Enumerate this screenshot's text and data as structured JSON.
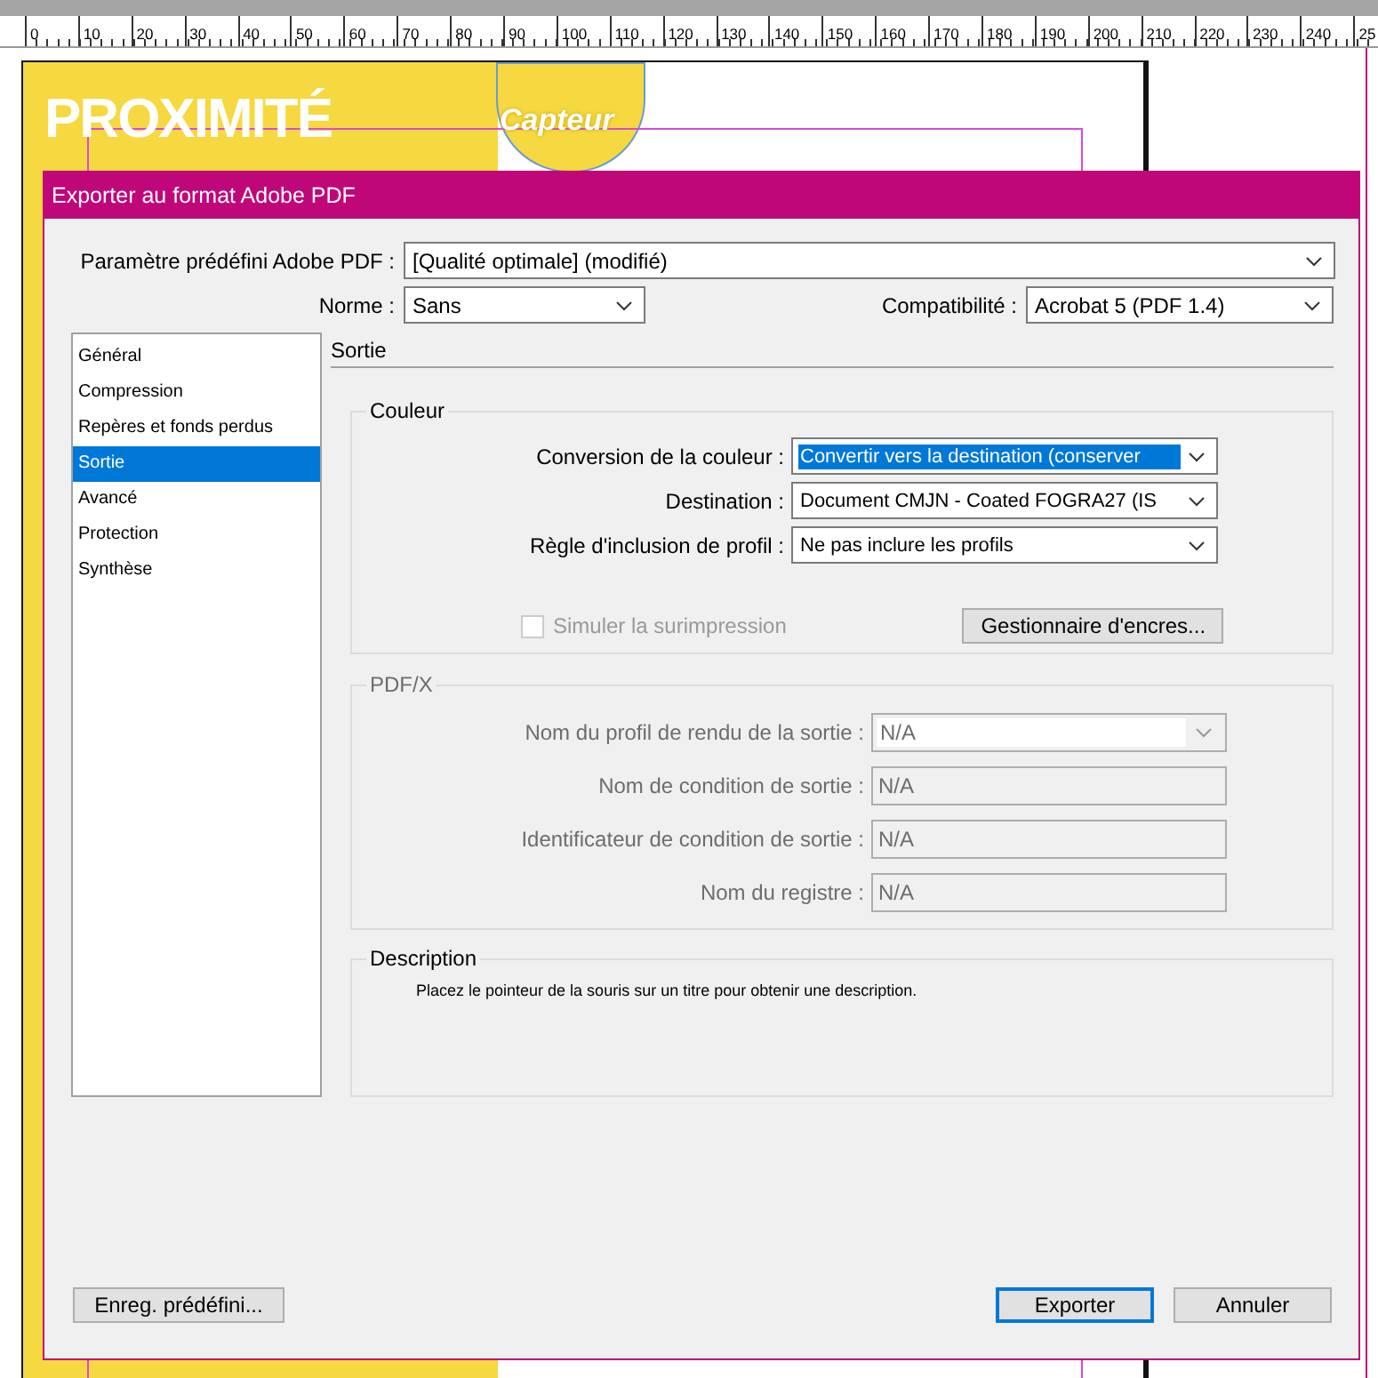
{
  "ruler": {
    "ticks": [
      "0",
      "10",
      "20",
      "30",
      "40",
      "50",
      "60",
      "70",
      "80",
      "90",
      "100",
      "110",
      "120",
      "130",
      "140",
      "150",
      "160",
      "170",
      "180",
      "190",
      "200",
      "210",
      "220",
      "230",
      "240",
      "25"
    ]
  },
  "document": {
    "headline": "PROXIMITÉ",
    "badge": "Capteur"
  },
  "dialog": {
    "title": "Exporter au format Adobe PDF",
    "preset": {
      "label": "Paramètre prédéfini Adobe PDF :",
      "value": "[Qualité optimale] (modifié)"
    },
    "standard": {
      "label": "Norme  :",
      "value": "Sans"
    },
    "compatibility": {
      "label": "Compatibilité :",
      "value": "Acrobat 5 (PDF 1.4)"
    },
    "sidebar": {
      "items": [
        {
          "label": "Général",
          "selected": false
        },
        {
          "label": "Compression",
          "selected": false
        },
        {
          "label": "Repères et fonds perdus",
          "selected": false
        },
        {
          "label": "Sortie",
          "selected": true
        },
        {
          "label": "Avancé",
          "selected": false
        },
        {
          "label": "Protection",
          "selected": false
        },
        {
          "label": "Synthèse",
          "selected": false
        }
      ]
    },
    "section_title": "Sortie",
    "color_group": {
      "title": "Couleur",
      "rows": [
        {
          "label": "Conversion de la couleur :",
          "value": "Convertir vers la destination (conserver",
          "highlighted": true
        },
        {
          "label": "Destination :",
          "value": "Document CMJN - Coated FOGRA27 (IS",
          "highlighted": false
        },
        {
          "label": "Règle d'inclusion de profil :",
          "value": "Ne pas inclure les profils",
          "highlighted": false
        }
      ],
      "simulate": {
        "label": "Simuler la surimpression",
        "checked": false,
        "disabled": true
      },
      "ink_button": "Gestionnaire d'encres..."
    },
    "pdfx": {
      "title": "PDF/X",
      "disabled": true,
      "rows": [
        {
          "label": "Nom du profil de rendu de la sortie :",
          "value": "N/A",
          "kind": "dropdown"
        },
        {
          "label": "Nom de condition de sortie :",
          "value": "N/A",
          "kind": "text"
        },
        {
          "label": "Identificateur de condition de sortie :",
          "value": "N/A",
          "kind": "text"
        },
        {
          "label": "Nom du registre :",
          "value": "N/A",
          "kind": "text"
        }
      ]
    },
    "description": {
      "title": "Description",
      "text": "Placez le pointeur de la souris sur un titre pour obtenir une description."
    },
    "buttons": [
      {
        "label": "Enreg. prédéfini...",
        "kind": "left",
        "default": false
      },
      {
        "label": "Exporter",
        "kind": "right",
        "default": true
      },
      {
        "label": "Annuler",
        "kind": "right",
        "default": false
      }
    ]
  }
}
